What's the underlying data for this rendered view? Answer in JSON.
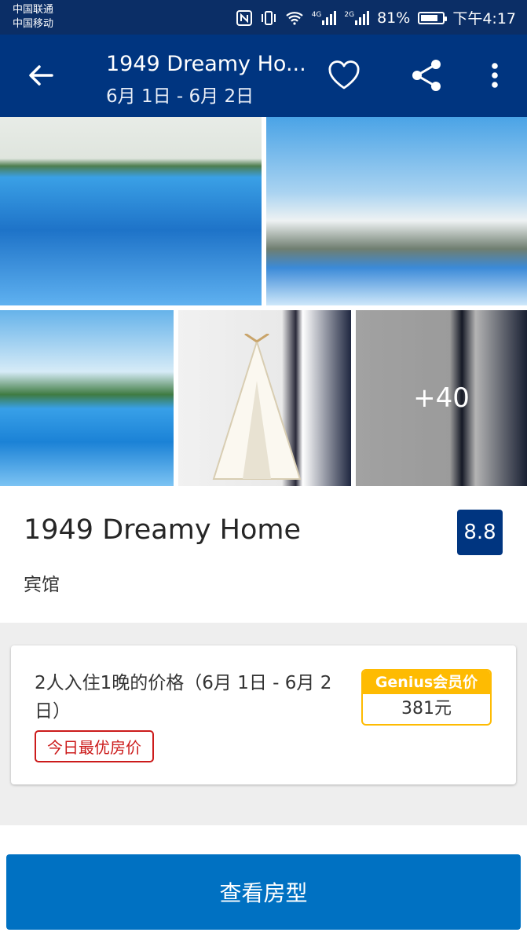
{
  "status_bar": {
    "carrier_1": "中国联通",
    "carrier_2": "中国移动",
    "net_1": "4G",
    "net_2": "2G",
    "battery": "81%",
    "battery_level": 0.81,
    "time": "下午4:17"
  },
  "header": {
    "title": "1949 Dreamy Ho...",
    "dates": "6月 1日 - 6月 2日"
  },
  "gallery": {
    "more_label": "+40"
  },
  "hotel": {
    "name": "1949 Dreamy Home",
    "type": "宾馆",
    "score": "8.8"
  },
  "price": {
    "description": "2人入住1晚的价格（6月 1日 - 6月 2日）",
    "best_badge": "今日最优房价",
    "genius_label": "Genius会员价",
    "amount": "381元"
  },
  "cta": {
    "label": "查看房型"
  },
  "colors": {
    "brand_dark": "#003580",
    "brand_button": "#0071c2",
    "genius_yellow": "#febb02",
    "badge_red": "#cc1b1b"
  },
  "icons": [
    "back-arrow-icon",
    "heart-icon",
    "share-icon",
    "more-vert-icon",
    "nfc-icon",
    "vibrate-icon",
    "wifi-icon",
    "signal-icon",
    "battery-icon"
  ]
}
